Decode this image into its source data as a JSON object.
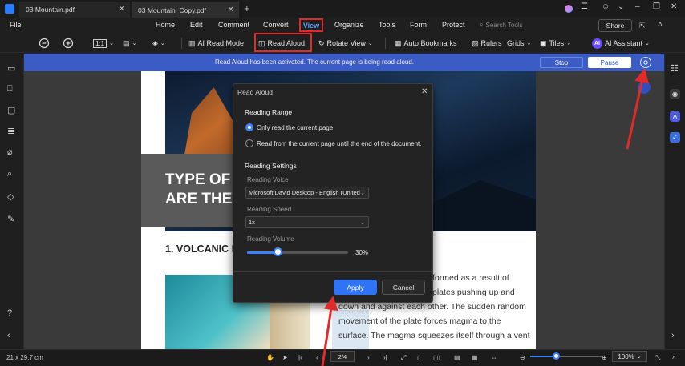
{
  "tabs": [
    {
      "label": "03 Mountain.pdf"
    },
    {
      "label": "03 Mountain_Copy.pdf"
    }
  ],
  "menu": {
    "file": "File",
    "items": [
      "Home",
      "Edit",
      "Comment",
      "Convert",
      "View",
      "Organize",
      "Tools",
      "Form",
      "Protect"
    ],
    "search_placeholder": "Search Tools",
    "share": "Share"
  },
  "toolbar": {
    "zoom_mode": "1:1",
    "ai_read_mode": "AI Read Mode",
    "read_aloud": "Read Aloud",
    "rotate_view": "Rotate View",
    "auto_bookmarks": "Auto Bookmarks",
    "rulers": "Rulers",
    "grids": "Grids",
    "tiles": "Tiles",
    "ai_badge": "AI",
    "ai_assistant": "AI Assistant"
  },
  "notice": {
    "text": "Read Aloud has been activated. The current page is being read aloud.",
    "stop": "Stop",
    "pause": "Pause"
  },
  "document": {
    "title_line1": "TYPE OF M",
    "title_line2": "ARE THEY",
    "section": "1. VOLCANIC M",
    "lines": [
      "formed as a result of",
      "plates pushing up and",
      "down and against each other. The sudden random",
      "movement of the plate forces magma to the",
      "surface. The magma squeezes itself through a vent"
    ]
  },
  "dialog": {
    "title": "Read Aloud",
    "reading_range": "Reading Range",
    "opt_current": "Only read the current page",
    "opt_until_end": "Read from the current page until the end of the document.",
    "reading_settings": "Reading Settings",
    "voice_label": "Reading Voice",
    "voice_value": "Microsoft David Desktop - English (United",
    "speed_label": "Reading Speed",
    "speed_value": "1x",
    "volume_label": "Reading Volume",
    "volume_value": "30%",
    "volume_fraction": 0.3,
    "apply": "Apply",
    "cancel": "Cancel"
  },
  "status": {
    "page_size": "21 x 29.7 cm",
    "page_current": "2",
    "page_total": "/4",
    "zoom": "100%",
    "zoom_fraction": 0.35
  },
  "colors": {
    "accent": "#2f74f5",
    "notice_bar": "#3b5cc4",
    "highlight": "#e12b2b"
  }
}
